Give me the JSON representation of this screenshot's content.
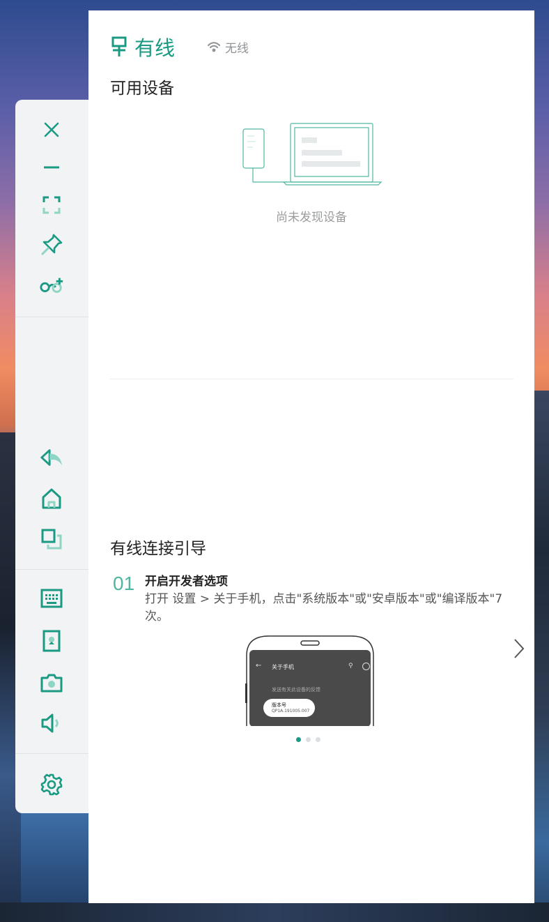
{
  "tabs": {
    "wired": {
      "label": "有线",
      "icon": "wired-plug-icon"
    },
    "wireless": {
      "label": "无线",
      "icon": "wifi-icon"
    }
  },
  "devices": {
    "title": "可用设备",
    "empty_text": "尚未发现设备"
  },
  "guide": {
    "title": "有线连接引导",
    "step_number": "01",
    "step_title": "开启开发者选项",
    "step_desc": "打开 设置 > 关于手机，点击\"系统版本\"或\"安卓版本\"或\"编译版本\"7次。",
    "phone": {
      "header": "关于手机",
      "subtitle": "发送有关此设备的反馈",
      "version_label": "版本号",
      "version_value": "QP1A.191005.007"
    },
    "carousel_page": 1,
    "carousel_count": 3
  },
  "toolbar": {
    "icons": [
      "close-icon",
      "minimize-icon",
      "fullscreen-icon",
      "pin-icon",
      "link-add-icon",
      "back-icon",
      "home-icon",
      "recent-apps-icon",
      "keyboard-icon",
      "screenshot-icon",
      "camera-icon",
      "volume-icon",
      "settings-icon"
    ]
  },
  "colors": {
    "accent": "#1a9a82",
    "muted": "#9a9c9e"
  }
}
